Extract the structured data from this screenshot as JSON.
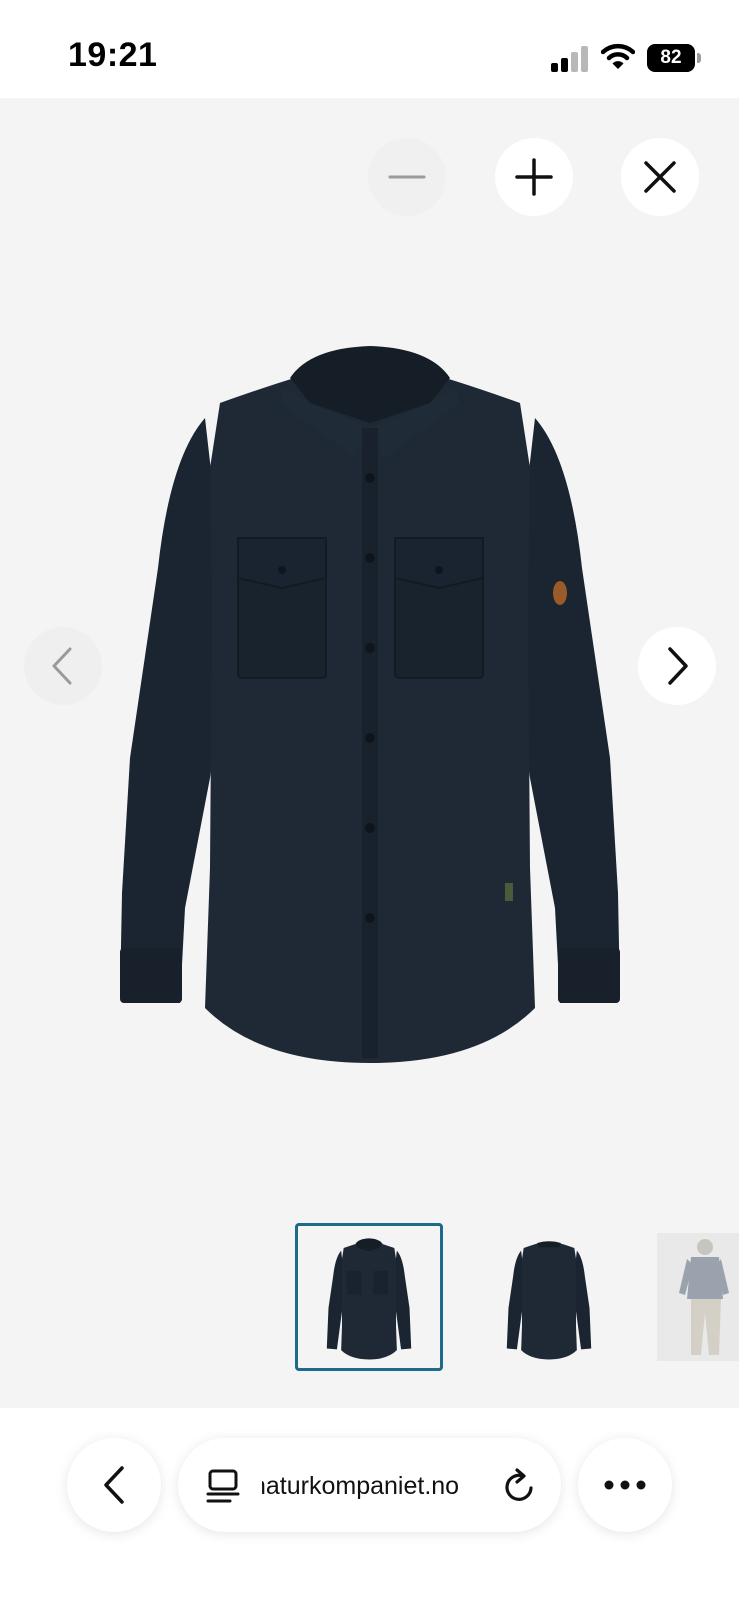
{
  "status_bar": {
    "time": "19:21",
    "battery_level": "82",
    "icons": [
      "cellular-signal-icon",
      "wifi-icon",
      "battery-icon"
    ]
  },
  "viewer": {
    "controls": {
      "zoom_out": "minus-icon",
      "zoom_in": "plus-icon",
      "close": "close-icon",
      "previous": "chevron-left-icon",
      "next": "chevron-right-icon"
    },
    "product_image": "dark navy long-sleeve shirt with two chest pockets, front view",
    "thumbnails": [
      {
        "view": "front",
        "selected": true
      },
      {
        "view": "back",
        "selected": false
      },
      {
        "view": "model",
        "selected": false
      }
    ],
    "colors": {
      "background": "#f4f4f4",
      "shirt": "#1a2430",
      "selected_border": "#1d6a8a"
    }
  },
  "browser_bar": {
    "url": "naturkompaniet.no",
    "icons": [
      "chevron-left-icon",
      "reader-mode-icon",
      "reload-icon",
      "more-icon"
    ]
  }
}
